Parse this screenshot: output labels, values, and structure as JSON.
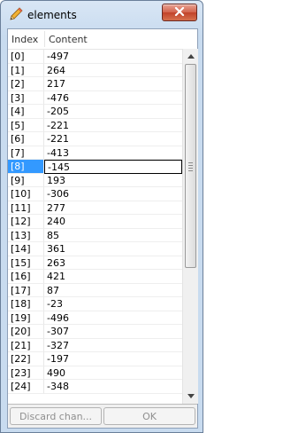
{
  "window": {
    "title": "elements"
  },
  "table": {
    "headers": {
      "index": "Index",
      "content": "Content"
    },
    "selected_row": 8,
    "rows": [
      {
        "index": "[0]",
        "value": "-497"
      },
      {
        "index": "[1]",
        "value": "264"
      },
      {
        "index": "[2]",
        "value": "217"
      },
      {
        "index": "[3]",
        "value": "-476"
      },
      {
        "index": "[4]",
        "value": "-205"
      },
      {
        "index": "[5]",
        "value": "-221"
      },
      {
        "index": "[6]",
        "value": "-221"
      },
      {
        "index": "[7]",
        "value": "-413"
      },
      {
        "index": "[8]",
        "value": "-145"
      },
      {
        "index": "[9]",
        "value": "193"
      },
      {
        "index": "[10]",
        "value": "-306"
      },
      {
        "index": "[11]",
        "value": "277"
      },
      {
        "index": "[12]",
        "value": "240"
      },
      {
        "index": "[13]",
        "value": "85"
      },
      {
        "index": "[14]",
        "value": "361"
      },
      {
        "index": "[15]",
        "value": "263"
      },
      {
        "index": "[16]",
        "value": "421"
      },
      {
        "index": "[17]",
        "value": "87"
      },
      {
        "index": "[18]",
        "value": "-23"
      },
      {
        "index": "[19]",
        "value": "-496"
      },
      {
        "index": "[20]",
        "value": "-307"
      },
      {
        "index": "[21]",
        "value": "-327"
      },
      {
        "index": "[22]",
        "value": "-197"
      },
      {
        "index": "[23]",
        "value": "490"
      },
      {
        "index": "[24]",
        "value": "-348"
      }
    ]
  },
  "buttons": {
    "discard": "Discard chan...",
    "ok": "OK"
  },
  "icons": {
    "title": "pencil-icon",
    "close": "close-icon",
    "scroll_up": "chevron-up-icon",
    "scroll_down": "chevron-down-icon"
  },
  "colors": {
    "selection": "#3399ff",
    "close_button": "#c1422a"
  }
}
